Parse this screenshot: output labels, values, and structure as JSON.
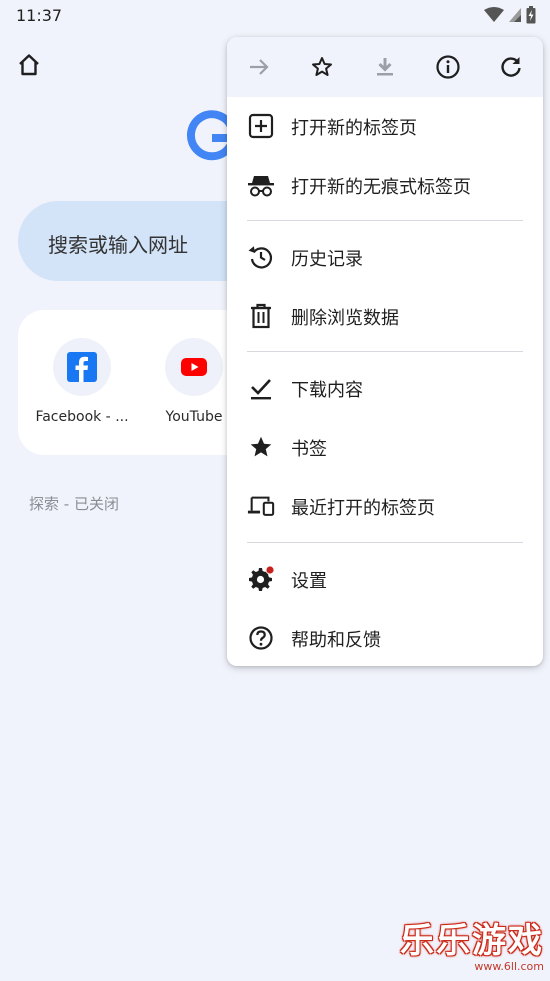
{
  "status_bar": {
    "time": "11:37"
  },
  "search": {
    "placeholder": "搜索或输入网址"
  },
  "shortcuts": [
    {
      "label": "Facebook - ...",
      "icon": "facebook-icon",
      "color": "#1877f2"
    },
    {
      "label": "YouTube",
      "icon": "youtube-icon",
      "color": "#ff0000"
    }
  ],
  "feed": {
    "status": "探索 - 已关闭"
  },
  "menu": {
    "toolbar": [
      {
        "name": "forward-icon",
        "enabled": false
      },
      {
        "name": "bookmark-star-icon",
        "enabled": true
      },
      {
        "name": "download-page-icon",
        "enabled": false
      },
      {
        "name": "page-info-icon",
        "enabled": true
      },
      {
        "name": "reload-icon",
        "enabled": true
      }
    ],
    "items": [
      {
        "label": "打开新的标签页",
        "icon": "new-tab-icon"
      },
      {
        "label": "打开新的无痕式标签页",
        "icon": "incognito-icon"
      },
      {
        "label": "历史记录",
        "icon": "history-icon"
      },
      {
        "label": "删除浏览数据",
        "icon": "trash-icon"
      },
      {
        "label": "下载内容",
        "icon": "downloads-icon"
      },
      {
        "label": "书签",
        "icon": "bookmarks-star-icon"
      },
      {
        "label": "最近打开的标签页",
        "icon": "recent-tabs-icon"
      },
      {
        "label": "设置",
        "icon": "settings-gear-icon"
      },
      {
        "label": "帮助和反馈",
        "icon": "help-icon"
      }
    ]
  },
  "watermark": {
    "title": "乐乐游戏",
    "url": "www.6ll.com"
  },
  "colors": {
    "background": "#f1f3fc",
    "search_box": "#d3e3f8",
    "google_blue": "#4285f4",
    "notification_dot": "#c5221f"
  }
}
